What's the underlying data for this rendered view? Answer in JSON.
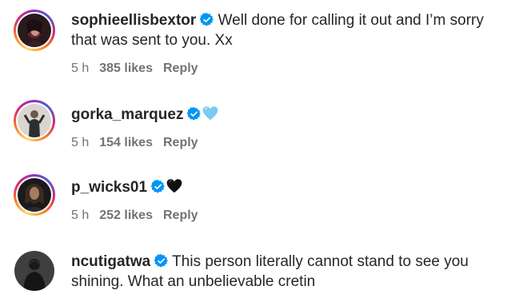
{
  "comments": [
    {
      "username": "sophieellisbextor",
      "verified": true,
      "text": "Well done for calling it out and I’m sorry that was sent to you. Xx",
      "time": "5 h",
      "likes": "385 likes",
      "reply": "Reply",
      "avatar_icon": "profile-photo"
    },
    {
      "username": "gorka_marquez",
      "verified": true,
      "text": "",
      "emoji_icon": "light-blue-heart-icon",
      "time": "5 h",
      "likes": "154 likes",
      "reply": "Reply",
      "avatar_icon": "profile-photo"
    },
    {
      "username": "p_wicks01",
      "verified": true,
      "text": "",
      "emoji_icon": "black-heart-icon",
      "time": "5 h",
      "likes": "252 likes",
      "reply": "Reply",
      "avatar_icon": "profile-photo"
    },
    {
      "username": "ncutigatwa",
      "verified": true,
      "text": "This person literally cannot stand to see you shining. What an unbelievable cretin",
      "avatar_icon": "profile-photo"
    }
  ],
  "colors": {
    "verified_blue": "#0095f6",
    "text": "#262626",
    "meta": "#737373",
    "light_blue_heart": "#79ccf0",
    "black_heart": "#111111"
  }
}
